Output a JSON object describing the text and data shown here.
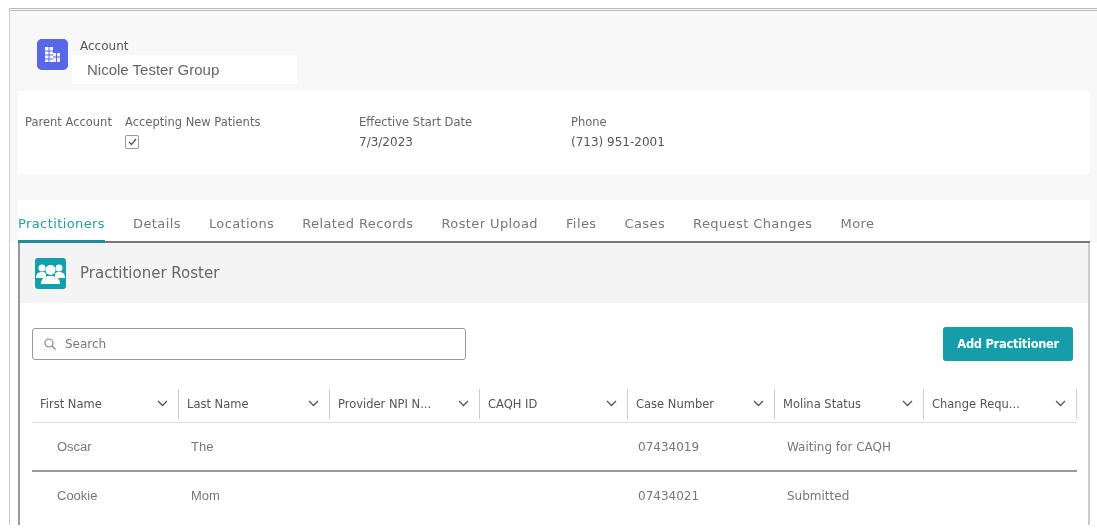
{
  "account": {
    "label": "Account",
    "name": "Nicole Tester Group"
  },
  "fields": [
    {
      "kind": "text",
      "label": "Parent Account"
    },
    {
      "kind": "checkbox",
      "label": "Accepting New Patients",
      "checked": true
    },
    {
      "kind": "text",
      "label": "Effective Start Date",
      "value": "7/3/2023"
    },
    {
      "kind": "text",
      "label": "Phone",
      "value": "(713) 951-2001"
    }
  ],
  "tabs": [
    {
      "label": "Practitioners",
      "selected": true
    },
    {
      "label": "Details",
      "selected": false
    },
    {
      "label": "Locations",
      "selected": false
    },
    {
      "label": "Related Records",
      "selected": false
    },
    {
      "label": "Roster Upload",
      "selected": false
    },
    {
      "label": "Files",
      "selected": false
    },
    {
      "label": "Cases",
      "selected": false
    },
    {
      "label": "Request Changes",
      "selected": false
    },
    {
      "label": "More",
      "selected": false
    }
  ],
  "roster": {
    "title": "Practitioner Roster",
    "search": {
      "placeholder": "Search"
    },
    "add_button": "Add Practitioner",
    "table": {
      "columns": [
        "First Name",
        "Last Name",
        "Provider NPI N...",
        "CAQH ID",
        "Case Number",
        "Molina Status",
        "Change Requ..."
      ],
      "rows": [
        [
          "Oscar",
          "The",
          "",
          "",
          "07434019",
          "Waiting for CAQH",
          ""
        ],
        [
          "Cookie",
          "Mom",
          "",
          "",
          "07434021",
          "Submitted",
          ""
        ]
      ]
    }
  }
}
